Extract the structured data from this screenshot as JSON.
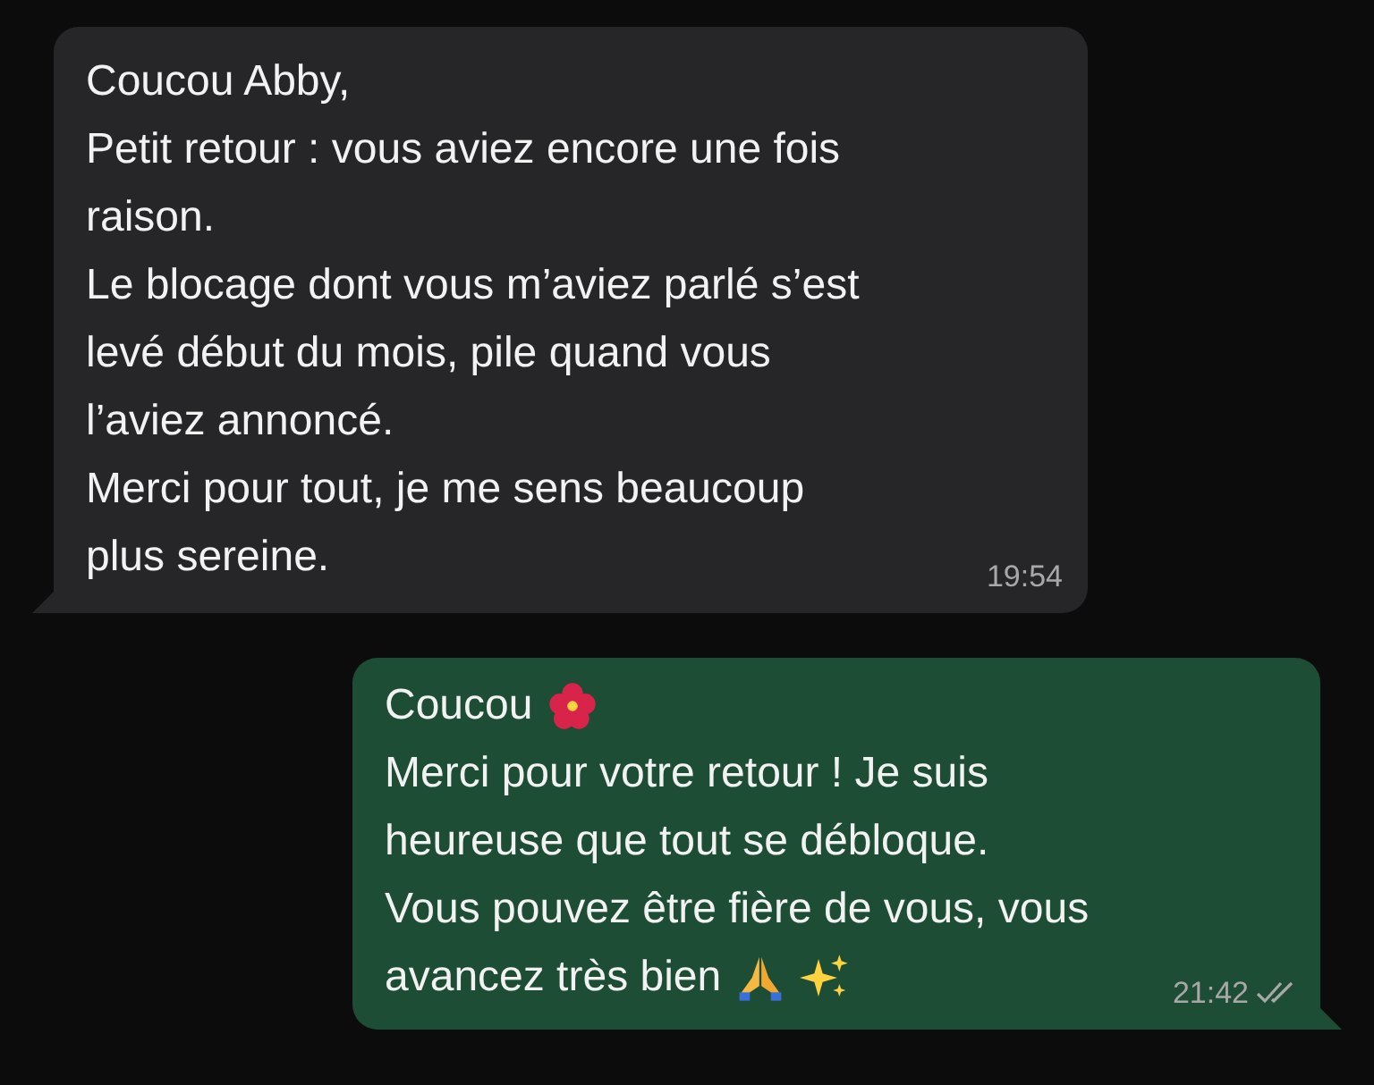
{
  "messages": [
    {
      "kind": "incoming",
      "time": "19:54",
      "read": false,
      "lines": [
        {
          "text": "Coucou Abby,"
        },
        {
          "text": "Petit retour : vous aviez encore une fois"
        },
        {
          "text": "raison."
        },
        {
          "text": "Le blocage dont vous m’aviez parlé s’est"
        },
        {
          "text": "levé début du mois, pile quand vous"
        },
        {
          "text": "l’aviez annoncé."
        },
        {
          "text": "Merci pour tout, je me sens beaucoup"
        },
        {
          "text": "plus sereine."
        }
      ]
    },
    {
      "kind": "outgoing",
      "time": "21:42",
      "read": true,
      "lines": [
        {
          "text": "Coucou",
          "icons": [
            {
              "kind": "flower"
            }
          ]
        },
        {
          "text": "Merci pour votre retour ! Je suis"
        },
        {
          "text": "heureuse que tout se débloque."
        },
        {
          "text": "Vous pouvez être fière de vous, vous"
        },
        {
          "text": "avancez très bien",
          "icons": [
            {
              "kind": "hands"
            },
            {
              "kind": "sparkles"
            }
          ]
        }
      ]
    }
  ]
}
